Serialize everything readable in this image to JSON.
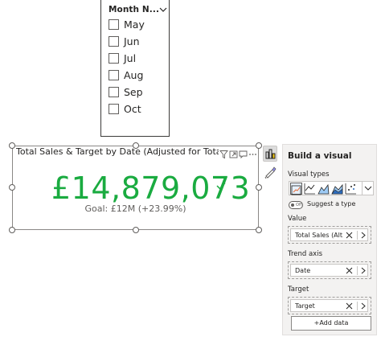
{
  "slicer": {
    "title": "Month N...",
    "items": [
      {
        "label": "May",
        "checked": false
      },
      {
        "label": "Jun",
        "checked": false
      },
      {
        "label": "Jul",
        "checked": false
      },
      {
        "label": "Aug",
        "checked": false
      },
      {
        "label": "Sep",
        "checked": false
      },
      {
        "label": "Oct",
        "checked": false
      }
    ]
  },
  "visual": {
    "title": "Total Sales & Target by Date (Adjusted for Tota",
    "kpi_value": "£14,879,073",
    "goal": "Goal: £12M (+23.99%)",
    "kpi_color": "#1aab40",
    "header_icons": [
      "filter-icon",
      "focus-mode-icon",
      "comment-icon",
      "more-options-icon"
    ]
  },
  "pane": {
    "title": "Build a visual",
    "visual_types_label": "Visual types",
    "visual_types": [
      "kpi-icon",
      "line-chart-icon",
      "area-chart-icon",
      "stacked-area-icon",
      "scatter-chart-icon"
    ],
    "toggle_text": "Off",
    "suggest_label": "Suggest a type",
    "value_label": "Value",
    "value_field": "Total Sales (Alt...",
    "trend_label": "Trend axis",
    "trend_field": "Date",
    "target_label": "Target",
    "target_field": "Target",
    "add_data": "+Add data"
  }
}
